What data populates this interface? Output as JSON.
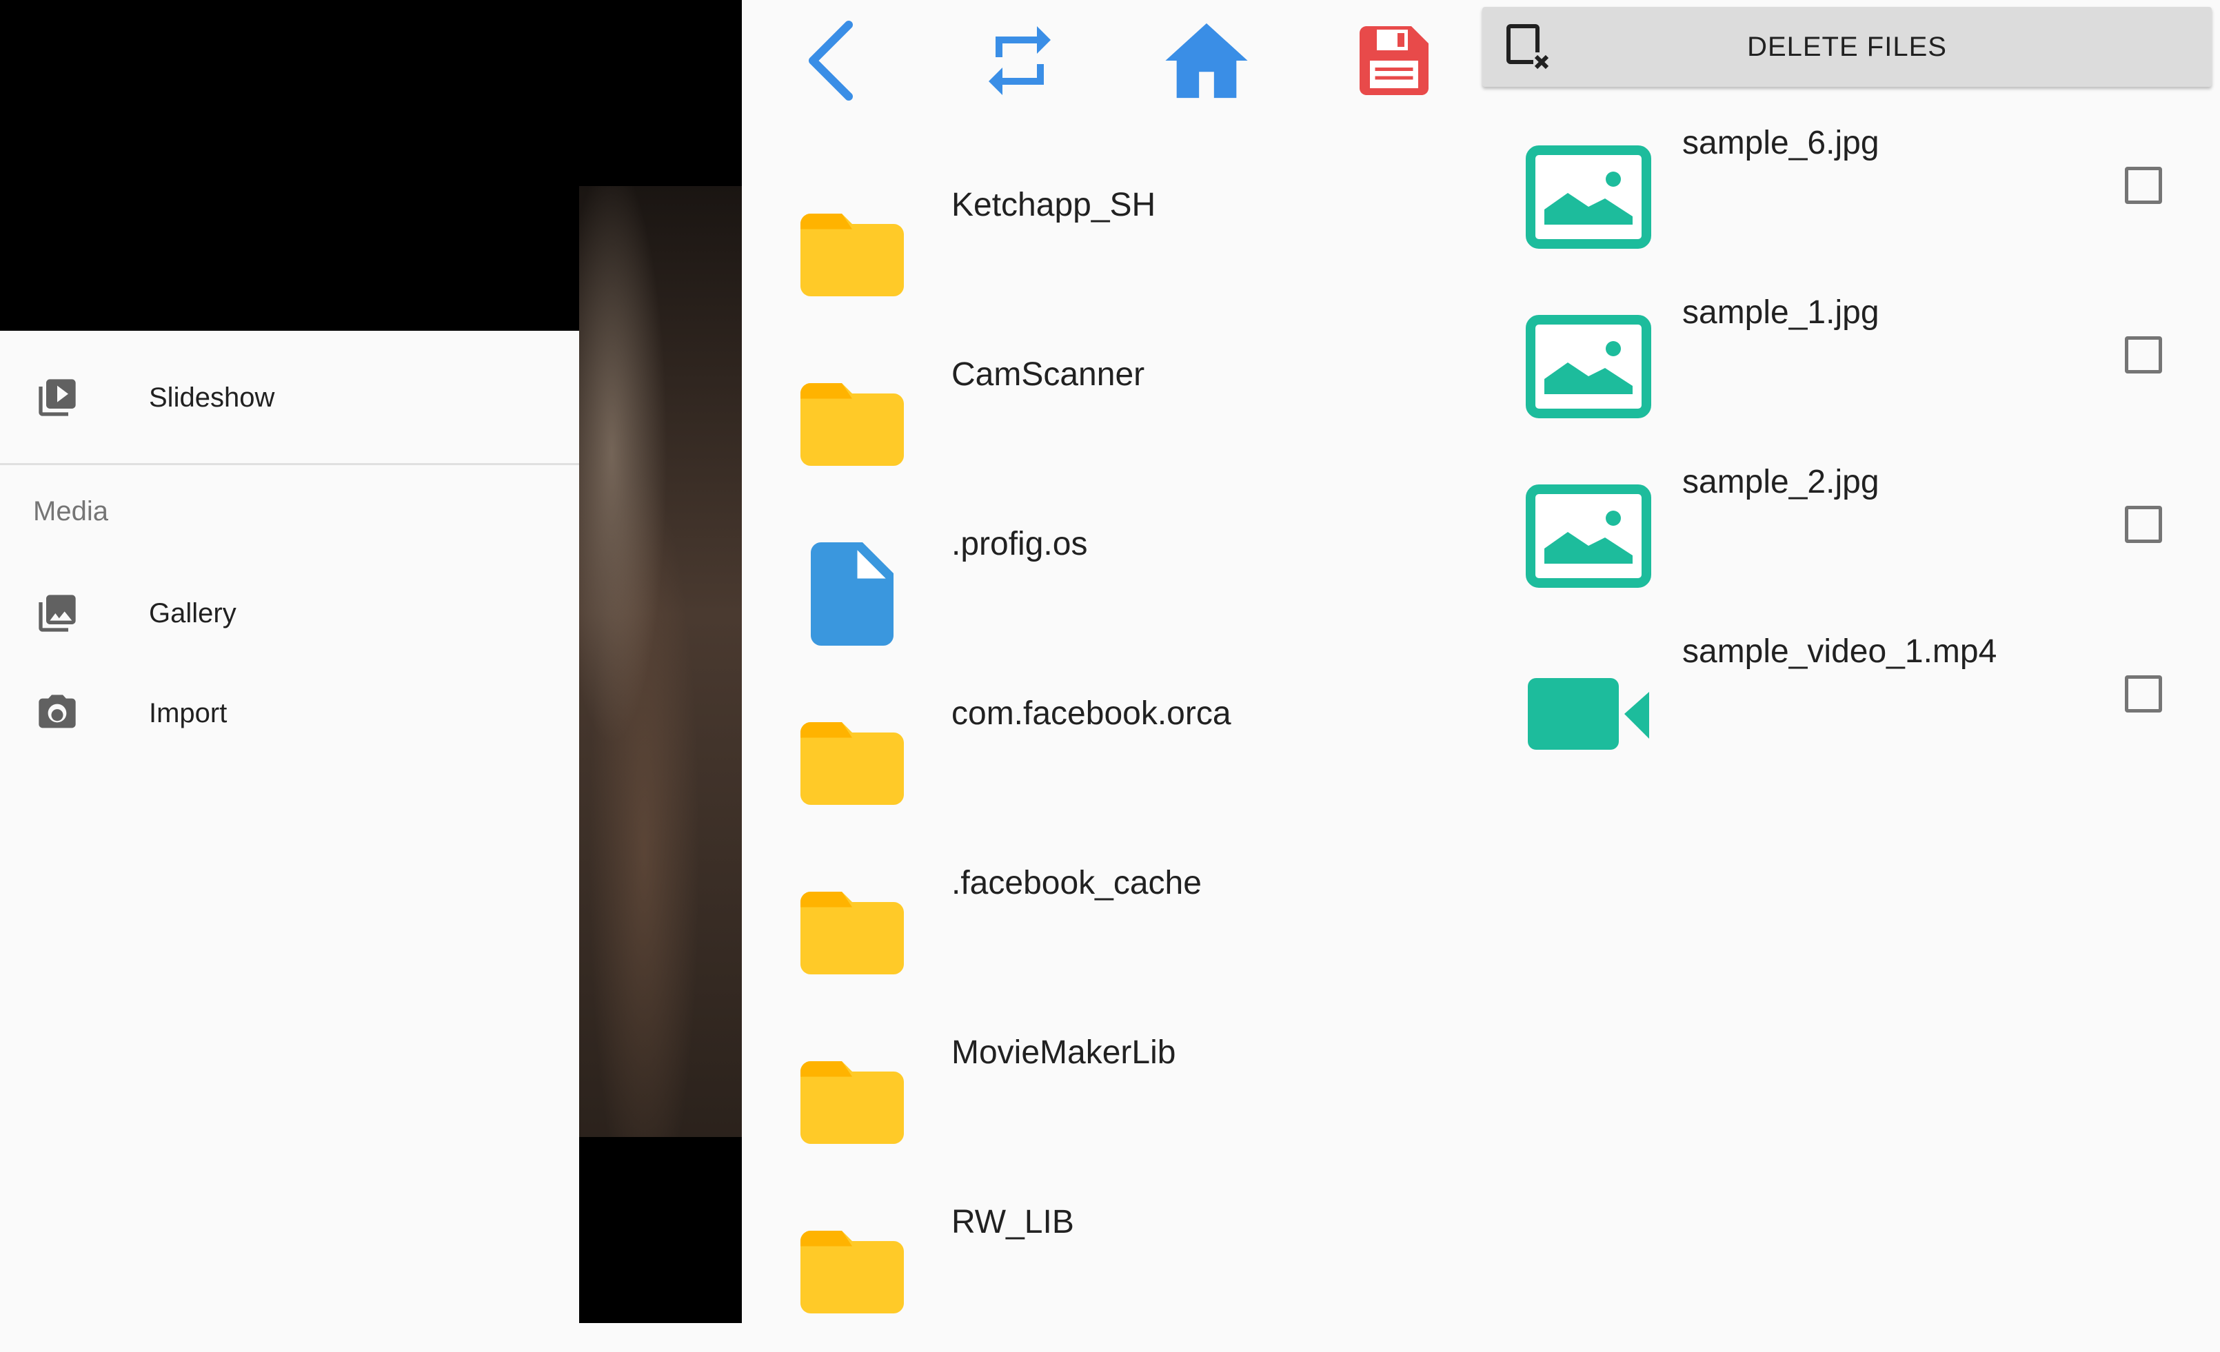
{
  "drawer": {
    "primary_item": {
      "label": "Slideshow",
      "icon": "slideshow-icon"
    },
    "section_header": "Media",
    "items": [
      {
        "label": "Gallery",
        "icon": "gallery-icon"
      },
      {
        "label": "Import",
        "icon": "camera-icon"
      }
    ]
  },
  "browser": {
    "toolbar": [
      "back-icon",
      "refresh-icon",
      "home-icon",
      "save-icon"
    ],
    "entries": [
      {
        "name": "Ketchapp_SH",
        "type": "folder"
      },
      {
        "name": "CamScanner",
        "type": "folder"
      },
      {
        "name": ".profig.os",
        "type": "file"
      },
      {
        "name": "com.facebook.orca",
        "type": "folder"
      },
      {
        "name": ".facebook_cache",
        "type": "folder"
      },
      {
        "name": "MovieMakerLib",
        "type": "folder"
      },
      {
        "name": "RW_LIB",
        "type": "folder"
      }
    ]
  },
  "delete_panel": {
    "button_label": "DELETE FILES",
    "files": [
      {
        "name": "sample_6.jpg",
        "type": "image",
        "checked": false
      },
      {
        "name": "sample_1.jpg",
        "type": "image",
        "checked": false
      },
      {
        "name": "sample_2.jpg",
        "type": "image",
        "checked": false
      },
      {
        "name": "sample_video_1.mp4",
        "type": "video",
        "checked": false
      }
    ]
  },
  "colors": {
    "folder": "#FFCA28",
    "file": "#3A97DE",
    "nav_blue": "#3A8EE6",
    "save_red": "#E84A4A",
    "media_teal": "#1DBC9C"
  }
}
